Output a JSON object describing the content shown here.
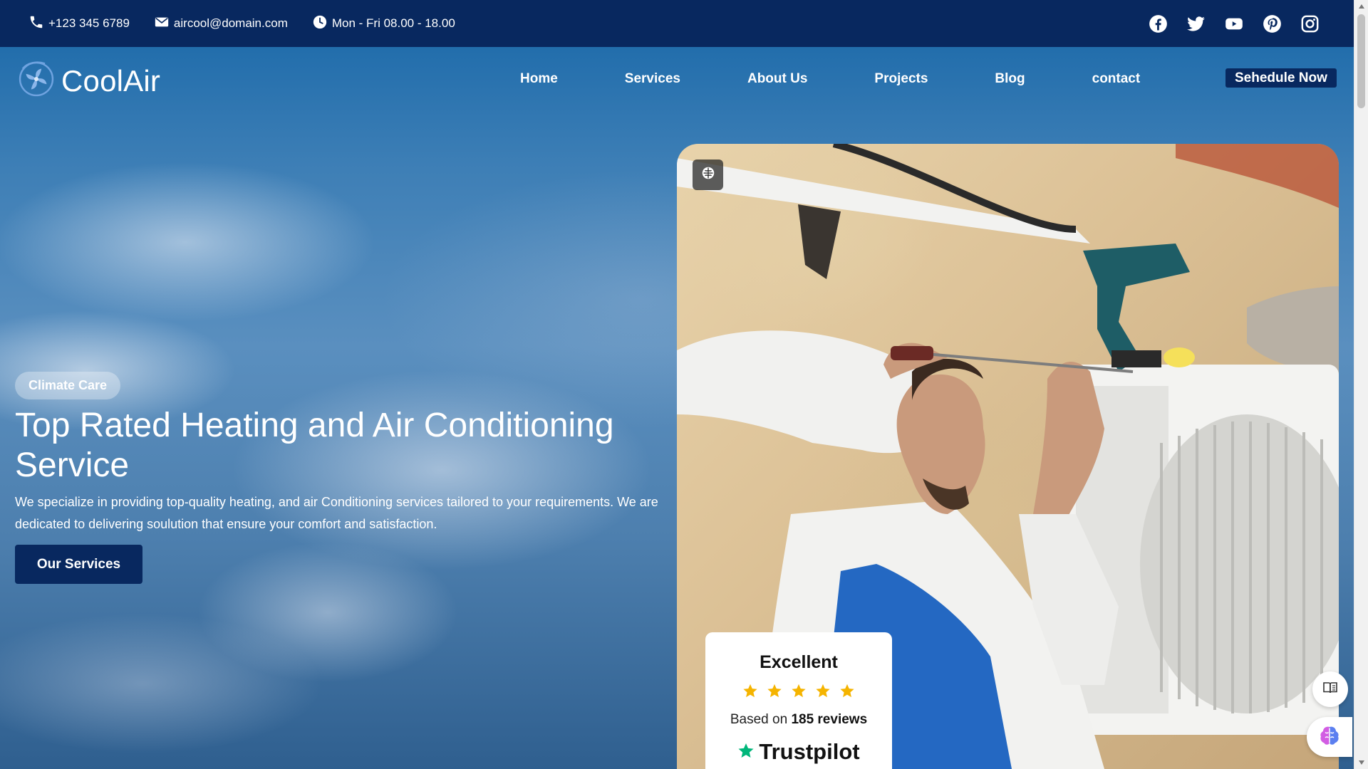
{
  "topbar": {
    "phone": "+123 345 6789",
    "email": "aircool@domain.com",
    "hours": "Mon - Fri 08.00 - 18.00",
    "social": [
      "facebook-icon",
      "twitter-icon",
      "youtube-icon",
      "pinterest-icon",
      "instagram-icon"
    ]
  },
  "nav": {
    "logo_text": "CoolAir",
    "items": [
      {
        "label": "Home"
      },
      {
        "label": "Services"
      },
      {
        "label": "About Us"
      },
      {
        "label": "Projects"
      },
      {
        "label": "Blog"
      },
      {
        "label": "contact"
      }
    ],
    "cta": "Sehedule Now"
  },
  "hero": {
    "badge": "Climate Care",
    "title": "Top Rated Heating and Air Conditioning Service",
    "description": "We specialize in providing top-quality heating, and air Conditioning services tailored to your requirements. We are dedicated to delivering soulution that ensure your comfort and satisfaction.",
    "button": "Our Services"
  },
  "review": {
    "title": "Excellent",
    "stars": 5,
    "based_prefix": "Based on",
    "based_count": "185 reviews",
    "brand": "Trustpilot"
  },
  "colors": {
    "topbar_bg": "#08285f",
    "accent_dark": "#08285f",
    "star": "#f5b400",
    "trustpilot_green": "#00b67a"
  }
}
